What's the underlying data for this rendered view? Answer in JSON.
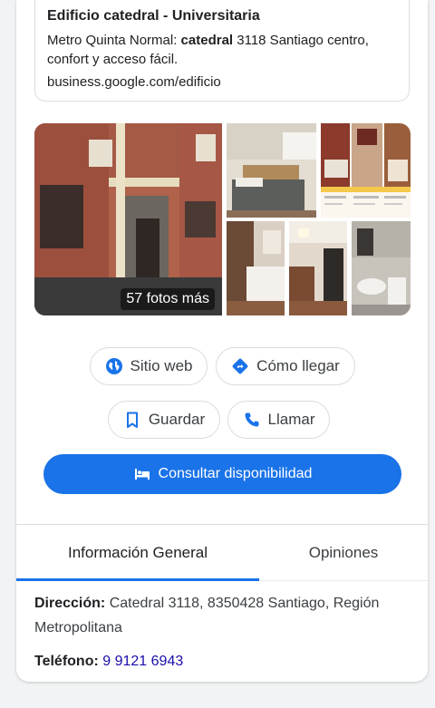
{
  "ad": {
    "title": "Edificio catedral - Universitaria",
    "desc_prefix": "Metro Quinta Normal: ",
    "desc_bold": "catedral",
    "desc_suffix": " 3118 Santiago centro, confort y acceso fácil.",
    "url": "business.google.com/edificio"
  },
  "photos": {
    "more_label": "57 fotos más"
  },
  "actions": {
    "website": "Sitio web",
    "directions": "Cómo llegar",
    "save": "Guardar",
    "call": "Llamar",
    "availability": "Consultar disponibilidad"
  },
  "tabs": {
    "info": "Información General",
    "reviews": "Opiniones"
  },
  "details": {
    "address_label": "Dirección:",
    "address_value": " Catedral 3118, 8350428 Santiago, Región Metropolitana",
    "phone_label": "Teléfono:",
    "phone_value": "9 9121 6943"
  },
  "colors": {
    "accent": "#1a73e8",
    "link": "#1a0dab"
  }
}
